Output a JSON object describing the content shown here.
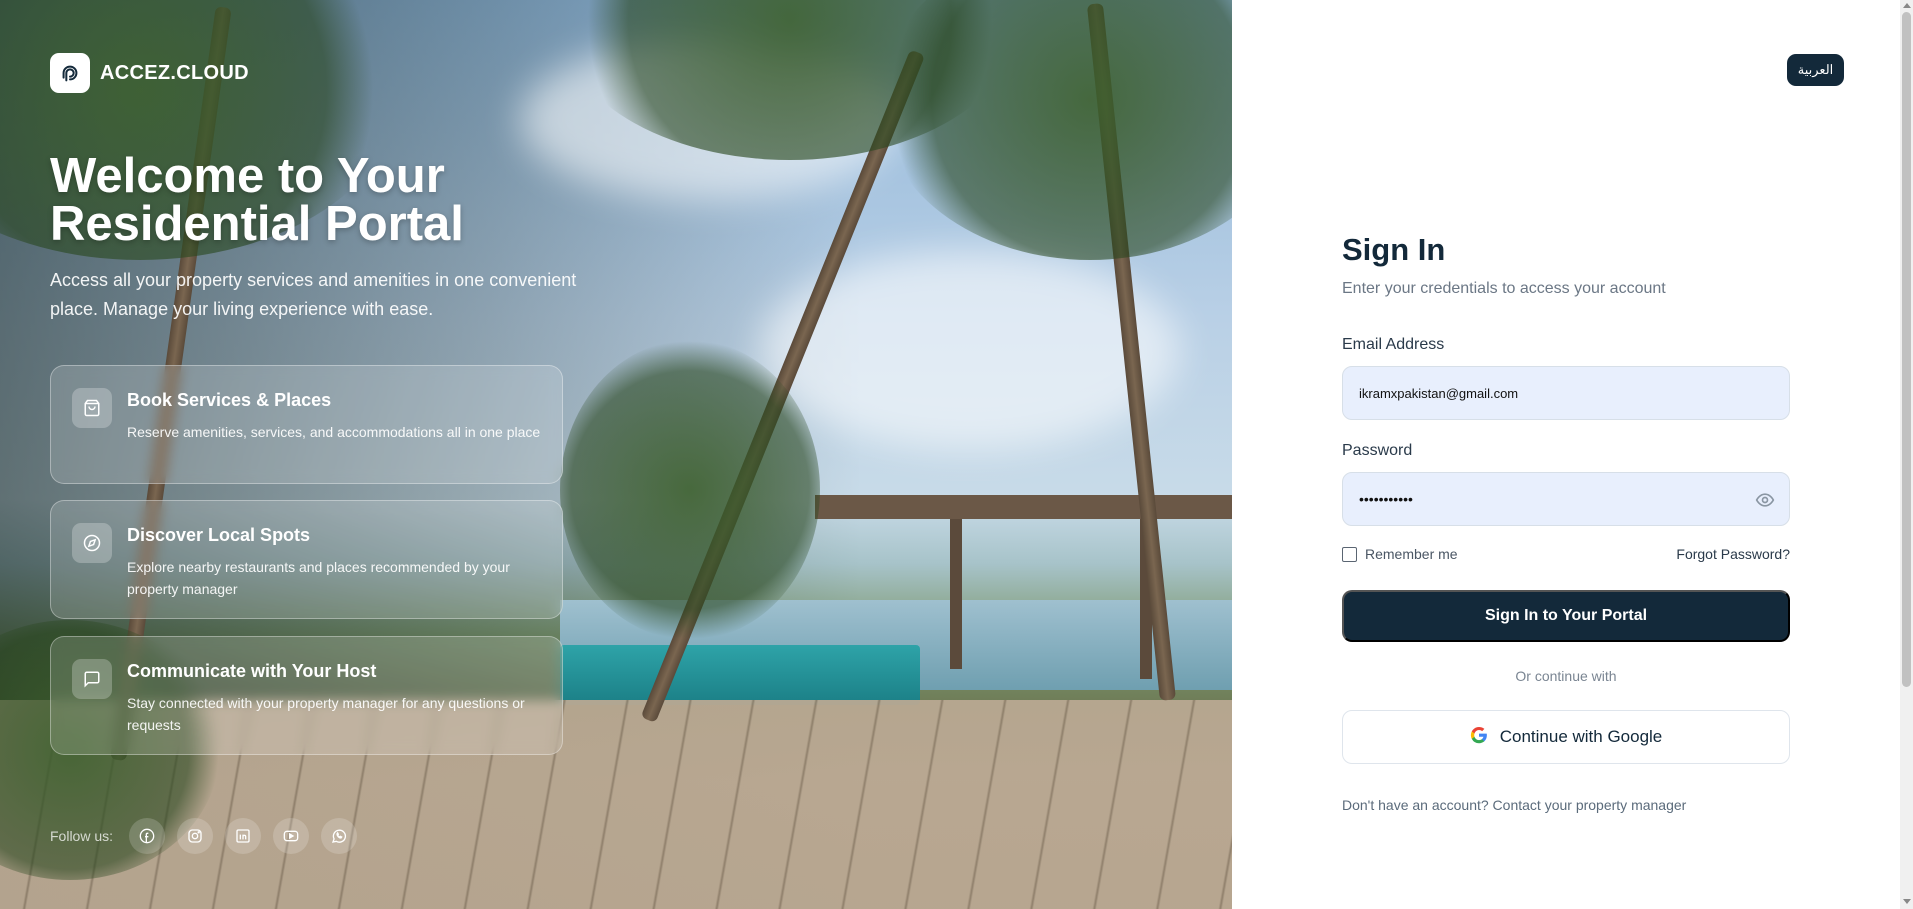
{
  "brand": {
    "name": "ACCEZ.CLOUD",
    "logo_icon": "accez-logo-icon"
  },
  "hero": {
    "title": "Welcome to Your Residential Portal",
    "subtitle": "Access all your property services and amenities in one convenient place. Manage your living experience with ease.",
    "features": [
      {
        "icon": "shopping-bag-icon",
        "title": "Book Services & Places",
        "description": "Reserve amenities, services, and accommodations all in one place"
      },
      {
        "icon": "compass-icon",
        "title": "Discover Local Spots",
        "description": "Explore nearby restaurants and places recommended by your property manager"
      },
      {
        "icon": "message-square-icon",
        "title": "Communicate with Your Host",
        "description": "Stay connected with your property manager for any questions or requests"
      }
    ],
    "follow_label": "Follow us:",
    "socials": [
      "facebook-icon",
      "instagram-icon",
      "linkedin-icon",
      "youtube-icon",
      "whatsapp-icon"
    ]
  },
  "language_toggle": "العربية",
  "signin": {
    "title": "Sign In",
    "subtitle": "Enter your credentials to access your account",
    "email_label": "Email Address",
    "email_value": "ikramxpakistan@gmail.com",
    "password_label": "Password",
    "password_value": "•••••••••••",
    "remember_label": "Remember me",
    "forgot_label": "Forgot Password?",
    "submit_label": "Sign In to Your Portal",
    "or_label": "Or continue with",
    "google_label": "Continue with Google",
    "contact_text": "Don't have an account? Contact your property manager"
  },
  "colors": {
    "primary": "#13293a",
    "input_bg": "#e8effd",
    "muted": "#6b7785"
  }
}
